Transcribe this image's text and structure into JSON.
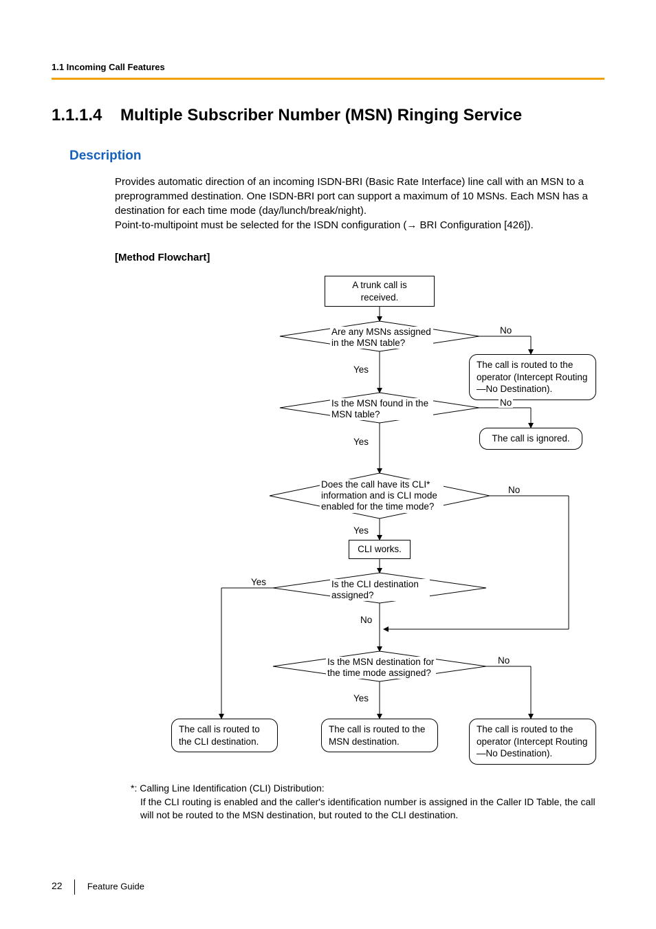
{
  "header": {
    "section_label": "1.1 Incoming Call Features"
  },
  "title": {
    "number": "1.1.1.4",
    "text": "Multiple Subscriber Number (MSN) Ringing Service"
  },
  "description": {
    "heading": "Description",
    "paragraph1": "Provides automatic direction of an incoming ISDN-BRI (Basic Rate Interface) line call with an MSN to a preprogrammed destination. One ISDN-BRI port can support a maximum of 10 MSNs. Each MSN has a destination for each time mode (day/lunch/break/night).",
    "paragraph2_pre": "Point-to-multipoint must be selected for the ISDN configuration (",
    "paragraph2_post": " BRI Configuration [426])."
  },
  "flowchart": {
    "heading": "[Method Flowchart]",
    "nodes": {
      "start": "A trunk call is received.",
      "q1": "Are any MSNs assigned in the MSN table?",
      "r1": "The call is routed to the operator (Intercept Routing—No Destination).",
      "q2": "Is the MSN found in the MSN table?",
      "r2": "The call is ignored.",
      "q3": "Does the call have its CLI* information and is CLI mode enabled for the time mode?",
      "cli_works": "CLI works.",
      "q4": "Is the CLI destination assigned?",
      "q5": "Is the MSN destination for the time mode assigned?",
      "end_cli": "The call is routed to the CLI destination.",
      "end_msn": "The call is routed to the MSN destination.",
      "end_op": "The call is routed to the operator (Intercept Routing—No Destination)."
    },
    "labels": {
      "yes": "Yes",
      "no": "No"
    }
  },
  "footnote": {
    "line1": "*: Calling Line Identification (CLI) Distribution:",
    "line2": "If the CLI routing is enabled and the caller's identification number is assigned in the Caller ID Table, the call will not be routed to the MSN destination, but routed to the CLI destination."
  },
  "footer": {
    "page": "22",
    "doc": "Feature Guide"
  }
}
